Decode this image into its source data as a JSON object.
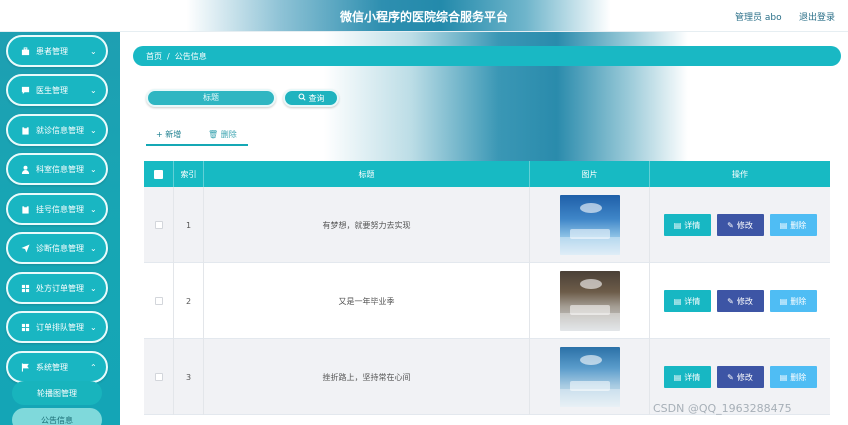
{
  "header": {
    "title": "微信小程序的医院综合服务平台",
    "user": "管理员 abo",
    "logout": "退出登录"
  },
  "sidebar": {
    "items": [
      {
        "label": "患者管理",
        "icon": "briefcase-icon"
      },
      {
        "label": "医生管理",
        "icon": "chat-icon"
      },
      {
        "label": "就诊信息管理",
        "icon": "clipboard-icon"
      },
      {
        "label": "科室信息管理",
        "icon": "user-icon"
      },
      {
        "label": "挂号信息管理",
        "icon": "clipboard-icon"
      },
      {
        "label": "诊断信息管理",
        "icon": "send-icon"
      },
      {
        "label": "处方订单管理",
        "icon": "grid-icon"
      },
      {
        "label": "订单排队管理",
        "icon": "grid-icon"
      },
      {
        "label": "系统管理",
        "icon": "flag-icon"
      }
    ],
    "subitems": [
      {
        "label": "轮播图管理"
      },
      {
        "label": "公告信息"
      }
    ]
  },
  "breadcrumb": {
    "home": "首页",
    "separator": "/",
    "current": "公告信息"
  },
  "search": {
    "placeholder": "标题",
    "button": "查询"
  },
  "tabs": {
    "add": "新增",
    "delete": "删除"
  },
  "table": {
    "columns": [
      "",
      "索引",
      "标题",
      "图片",
      "操作"
    ],
    "rows": [
      {
        "index": "1",
        "title": "有梦想，就要努力去实现",
        "image": "hospital-ward-image"
      },
      {
        "index": "2",
        "title": "又是一年毕业季",
        "image": "hospital-corridor-image"
      },
      {
        "index": "3",
        "title": "挫折路上，坚持常在心间",
        "image": "operating-room-image"
      }
    ],
    "actions": {
      "detail": "详情",
      "edit": "修改",
      "delete": "删除"
    }
  },
  "watermark": "CSDN @QQ_1963288475",
  "colors": {
    "accent": "#17bac3",
    "edit_button": "#3d55a5",
    "delete_button": "#4fbdf4",
    "sidebar": "#19b6c2"
  }
}
